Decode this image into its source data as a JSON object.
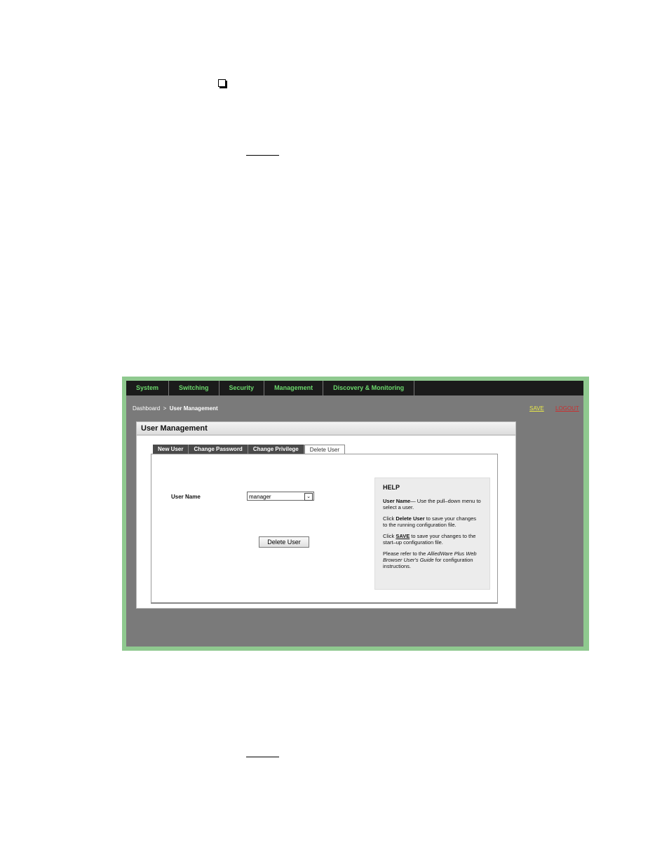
{
  "nav": [
    "System",
    "Switching",
    "Security",
    "Management",
    "Discovery & Monitoring"
  ],
  "breadcrumb": {
    "root": "Dashboard",
    "sep": ">",
    "current": "User Management"
  },
  "header_links": {
    "save": "SAVE",
    "logout": "LOGOUT"
  },
  "panel": {
    "title": "User Management"
  },
  "tabs": [
    "New User",
    "Change Password",
    "Change Privilege",
    "Delete User"
  ],
  "form": {
    "label": "User Name",
    "selected": "manager",
    "button": "Delete User"
  },
  "help": {
    "title": "HELP",
    "p1_bold": "User Name",
    "p1_rest": "— Use the pull–down menu to select a user.",
    "p2_pre": "Click ",
    "p2_bold": "Delete User",
    "p2_rest": " to save your changes to the running configuration file.",
    "p3_pre": "Click ",
    "p3_bold": "SAVE",
    "p3_rest": " to save your changes to the start–up configuration file.",
    "p4_pre": "Please refer to the ",
    "p4_ital": "AlliedWare Plus Web Browser User's Guide",
    "p4_rest": " for configuration instructions."
  },
  "colors": {
    "frame": "#8fc98f",
    "nav_bg": "#1b1b1b",
    "nav_text": "#6cd86c",
    "content_bg": "#7a7a7a"
  }
}
